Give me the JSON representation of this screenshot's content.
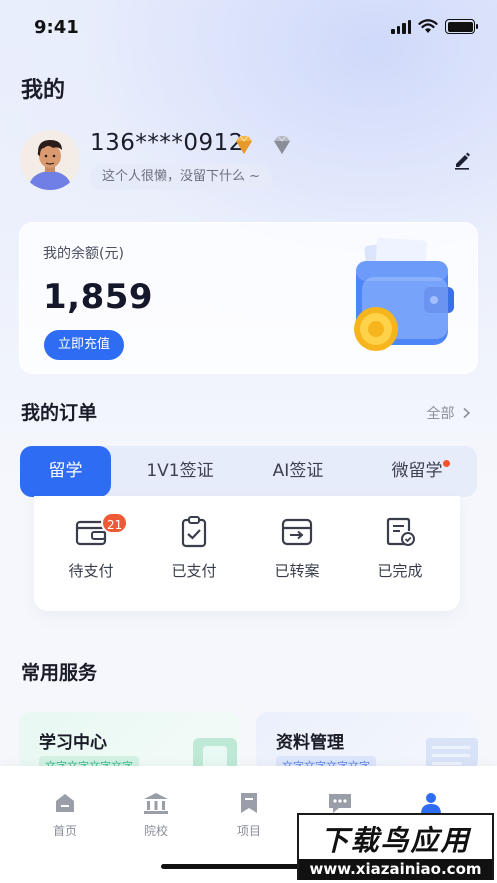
{
  "status_bar": {
    "time": "9:41"
  },
  "page": {
    "title": "我的"
  },
  "profile": {
    "phone": "136****0912",
    "bio": "这个人很懒，没留下什么 ~"
  },
  "balance": {
    "label": "我的余额(元)",
    "value": "1,859",
    "recharge_label": "立即充值"
  },
  "orders": {
    "title": "我的订单",
    "all_label": "全部",
    "tabs": [
      {
        "label": "留学",
        "active": true
      },
      {
        "label": "1V1签证",
        "active": false
      },
      {
        "label": "AI签证",
        "active": false
      },
      {
        "label": "微留学",
        "active": false,
        "dot": true
      }
    ],
    "items": [
      {
        "label": "待支付",
        "icon": "wallet-icon",
        "count": "21"
      },
      {
        "label": "已支付",
        "icon": "clipboard-check-icon"
      },
      {
        "label": "已转案",
        "icon": "transfer-box-icon"
      },
      {
        "label": "已完成",
        "icon": "document-check-icon"
      }
    ]
  },
  "services": {
    "title": "常用服务",
    "items": [
      {
        "title": "学习中心",
        "tag": "文字文字文字文字"
      },
      {
        "title": "资料管理",
        "tag": "文字文字文字文字"
      }
    ]
  },
  "tab_bar": {
    "items": [
      {
        "label": "首页",
        "icon": "home-icon"
      },
      {
        "label": "院校",
        "icon": "school-icon"
      },
      {
        "label": "项目",
        "icon": "bookmark-icon"
      },
      {
        "label": "消息",
        "icon": "chat-icon"
      },
      {
        "label": "我的",
        "icon": "person-icon",
        "active": true
      }
    ]
  },
  "watermark": {
    "title": "下载鸟应用",
    "url": "www.xiazainiao.com"
  },
  "colors": {
    "accent": "#2f6cf4",
    "badge": "#ef5a36",
    "text": "#1a1c28"
  }
}
